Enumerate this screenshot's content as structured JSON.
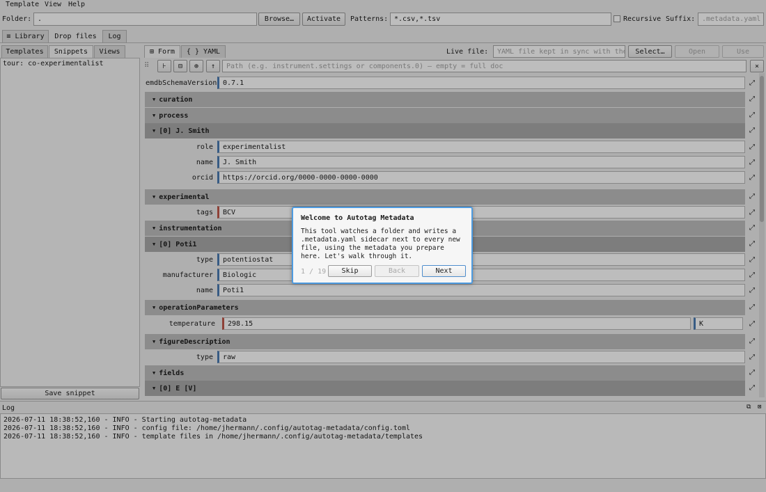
{
  "menubar": {
    "items": [
      "Template",
      "View",
      "Help"
    ]
  },
  "toolbar": {
    "folder_label": "Folder:",
    "folder_value": ".",
    "browse_label": "Browse…",
    "activate_label": "Activate",
    "patterns_label": "Patterns:",
    "patterns_value": "*.csv,*.tsv",
    "recursive_label": "Recursive",
    "suffix_label": "Suffix:",
    "suffix_placeholder": ".metadata.yaml"
  },
  "top_tabs": [
    "≡ Library",
    "Drop files",
    "Log"
  ],
  "left_panel": {
    "tabs": [
      "Templates",
      "Snippets",
      "Views"
    ],
    "items": [
      "tour: co-experimentalist"
    ],
    "save_snippet_label": "Save snippet"
  },
  "editor": {
    "tabs": [
      "⊞ Form",
      "{ } YAML"
    ],
    "live_file_label": "Live file:",
    "live_file_placeholder": "YAML file kept in sync with the…",
    "select_label": "Select…",
    "open_label": "Open",
    "use_label": "Use",
    "path_placeholder": "Path (e.g. instrument.settings or components.0) — empty = full doc",
    "close_icon": "×",
    "schema_label": "emdbSchemaVersion",
    "schema_value": "0.7.1",
    "sections": {
      "curation": "curation",
      "process": "process",
      "process_item": "[0]  J. Smith",
      "experimental": "experimental",
      "instrumentation": "instrumentation",
      "instrumentation_item": "[0]  Poti1",
      "operation": "operationParameters",
      "figure": "figureDescription",
      "fields": "fields",
      "fields_item": "[0]  E [V]"
    },
    "fields": {
      "role_label": "role",
      "role_value": "experimentalist",
      "name_label": "name",
      "name_value": "J. Smith",
      "orcid_label": "orcid",
      "orcid_value": "https://orcid.org/0000-0000-0000-0000",
      "tags_label": "tags",
      "tags_value": "BCV",
      "type_label": "type",
      "type_value": "potentiostat",
      "manufacturer_label": "manufacturer",
      "manufacturer_value": "Biologic",
      "inst_name_label": "name",
      "inst_name_value": "Poti1",
      "temperature_label": "temperature",
      "temperature_value": "298.15",
      "temperature_unit": "K",
      "fig_type_label": "type",
      "fig_type_value": "raw"
    }
  },
  "log": {
    "title": "Log",
    "lines": [
      "2026-07-11 18:38:52,160 - INFO - Starting autotag-metadata",
      "2026-07-11 18:38:52,160 - INFO - config file: /home/jhermann/.config/autotag-metadata/config.toml",
      "2026-07-11 18:38:52,160 - INFO - template files in /home/jhermann/.config/autotag-metadata/templates"
    ]
  },
  "dialog": {
    "title": "Welcome to Autotag Metadata",
    "body": "This tool watches a folder and writes a .metadata.yaml sidecar next to every new file, using the metadata you prepare here. Let's walk through it.",
    "progress": "1 / 19",
    "skip_label": "Skip",
    "back_label": "Back",
    "next_label": "Next"
  },
  "colors": {
    "accent_blue": "#4b7bb3",
    "accent_red": "#c0584b",
    "dialog_border": "#4e9be0"
  }
}
